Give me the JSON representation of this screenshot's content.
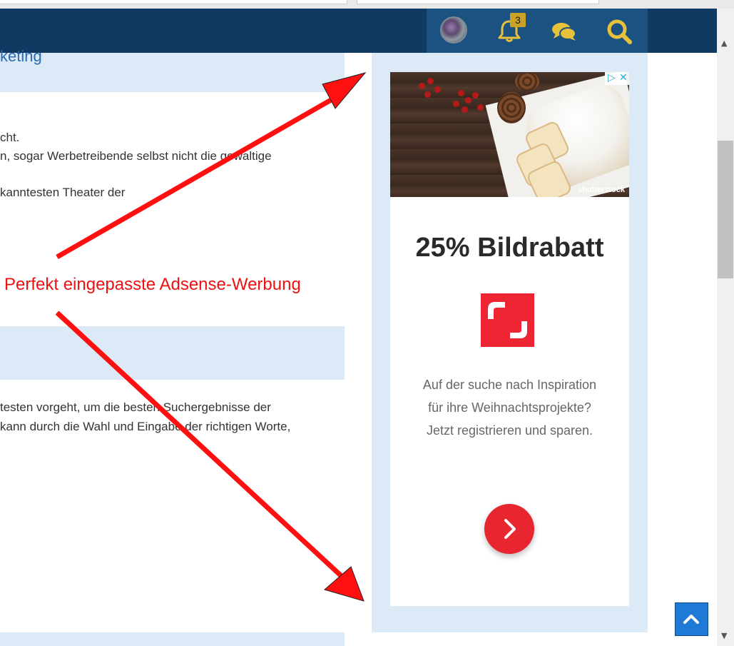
{
  "browser": {
    "tabs": [
      "",
      ""
    ]
  },
  "header": {
    "avatar": "user-avatar",
    "notifications": {
      "icon": "bell-icon",
      "count": "3"
    },
    "chat_icon": "chat-icon",
    "search_icon": "search-icon"
  },
  "article": {
    "heading_fragment": "keting",
    "para1": [
      "cht.",
      "n, sogar Werbetreibende selbst nicht die gewaltige",
      "kanntesten Theater der"
    ],
    "para2": [
      "testen vorgeht, um die besten Suchergebnisse der",
      "kann durch die Wahl und Eingabe der richtigen Worte,"
    ]
  },
  "annotation": {
    "text": "Perfekt eingepasste Adsense-Werbung",
    "color": "#ee1111"
  },
  "ad": {
    "watermark": "shutterstock",
    "title": "25% Bildrabatt",
    "text_lines": [
      "Auf der suche nach Inspiration",
      "für ihre Weihnachtsprojekte?",
      "Jetzt registrieren und sparen."
    ],
    "brand_color": "#ee2533",
    "adchoices_icon": "adchoices-icon",
    "close_icon": "close-icon",
    "cta_icon": "chevron-right-icon"
  },
  "ui": {
    "back_to_top_icon": "chevron-up-icon",
    "header_color": "#113a63",
    "sidebar_color": "#dce9f7"
  }
}
